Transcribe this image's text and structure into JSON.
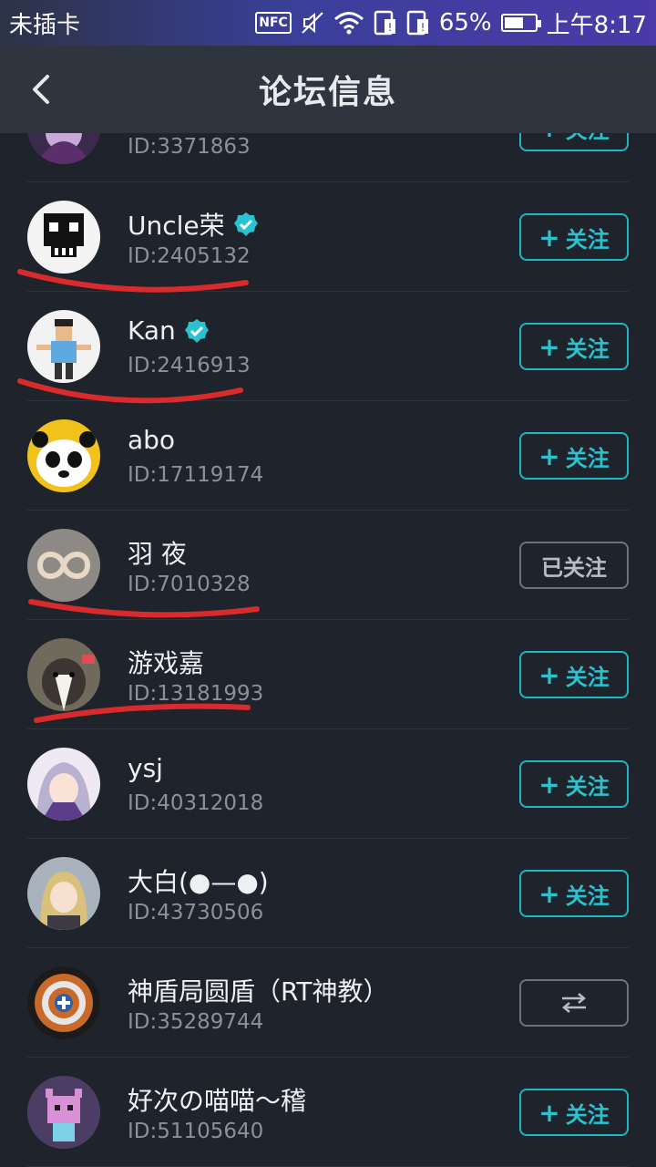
{
  "status_bar": {
    "carrier": "未插卡",
    "nfc": "NFC",
    "battery_percent": "65%",
    "battery_level": 0.65,
    "time": "上午8:17"
  },
  "header": {
    "title": "论坛信息"
  },
  "colors": {
    "accent": "#29c3cf",
    "background": "#1f232b",
    "underline": "#d92b2b"
  },
  "users": [
    {
      "name": "",
      "id": "ID:3371863",
      "verified": false,
      "button": "+ 关注",
      "state": "follow",
      "avatar": "purple-anime-avatar"
    },
    {
      "name": "Uncle荣",
      "id": "ID:2405132",
      "verified": true,
      "button": "关注",
      "state": "follow",
      "avatar": "pixel-skull-avatar"
    },
    {
      "name": "Kan",
      "id": "ID:2416913",
      "verified": true,
      "button": "关注",
      "state": "follow",
      "avatar": "pixel-man-avatar"
    },
    {
      "name": "abo",
      "id": "ID:17119174",
      "verified": false,
      "button": "关注",
      "state": "follow",
      "avatar": "panda-avatar"
    },
    {
      "name": "羽 夜",
      "id": "ID:7010328",
      "verified": false,
      "button": "已关注",
      "state": "followed",
      "avatar": "infinity-ring-avatar"
    },
    {
      "name": "游戏嘉",
      "id": "ID:13181993",
      "verified": false,
      "button": "关注",
      "state": "follow",
      "avatar": "dog-avatar"
    },
    {
      "name": "ysj",
      "id": "ID:40312018",
      "verified": false,
      "button": "关注",
      "state": "follow",
      "avatar": "anime-girl-avatar"
    },
    {
      "name": "大白(●—●)",
      "id": "ID:43730506",
      "verified": false,
      "button": "关注",
      "state": "follow",
      "avatar": "blonde-anime-avatar"
    },
    {
      "name": "神盾局圆盾（RT神教）",
      "id": "ID:35289744",
      "verified": false,
      "button": "⇆",
      "state": "mutual",
      "avatar": "pixel-shield-avatar"
    },
    {
      "name": "好次の喵喵～稽",
      "id": "ID:51105640",
      "verified": false,
      "button": "关注",
      "state": "follow",
      "avatar": "pixel-cat-avatar"
    }
  ]
}
